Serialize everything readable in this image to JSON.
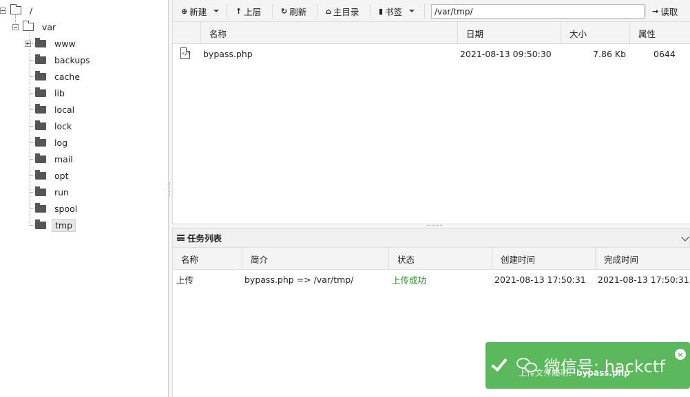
{
  "tree": {
    "root": "/",
    "var": "var",
    "children": [
      "www",
      "backups",
      "cache",
      "lib",
      "local",
      "lock",
      "log",
      "mail",
      "opt",
      "run",
      "spool",
      "tmp"
    ],
    "selected": "tmp"
  },
  "toolbar": {
    "new_label": "新建",
    "up_label": "上层",
    "refresh_label": "刷新",
    "home_label": "主目录",
    "bookmark_label": "书签",
    "path_value": "/var/tmp/",
    "read_label": "读取"
  },
  "file_table": {
    "headers": [
      "名称",
      "日期",
      "大小",
      "属性"
    ],
    "rows": [
      {
        "name": "bypass.php",
        "date": "2021-08-13 09:50:30",
        "size": "7.86 Kb",
        "perms": "0644"
      }
    ]
  },
  "tasks": {
    "title": "任务列表",
    "headers": [
      "名称",
      "简介",
      "状态",
      "创建时间",
      "完成时间"
    ],
    "rows": [
      {
        "name": "上传",
        "desc": "bypass.php => /var/tmp/",
        "status": "上传成功",
        "created": "2021-08-13 17:50:31",
        "finished": "2021-08-13 17:50:31"
      }
    ],
    "status_color": "#2a8a2a"
  },
  "toast": {
    "message_prefix": "上传文件成功：",
    "message_file": "bypass.php",
    "watermark": "微信号: hackctf",
    "color": "#5cb85c"
  }
}
